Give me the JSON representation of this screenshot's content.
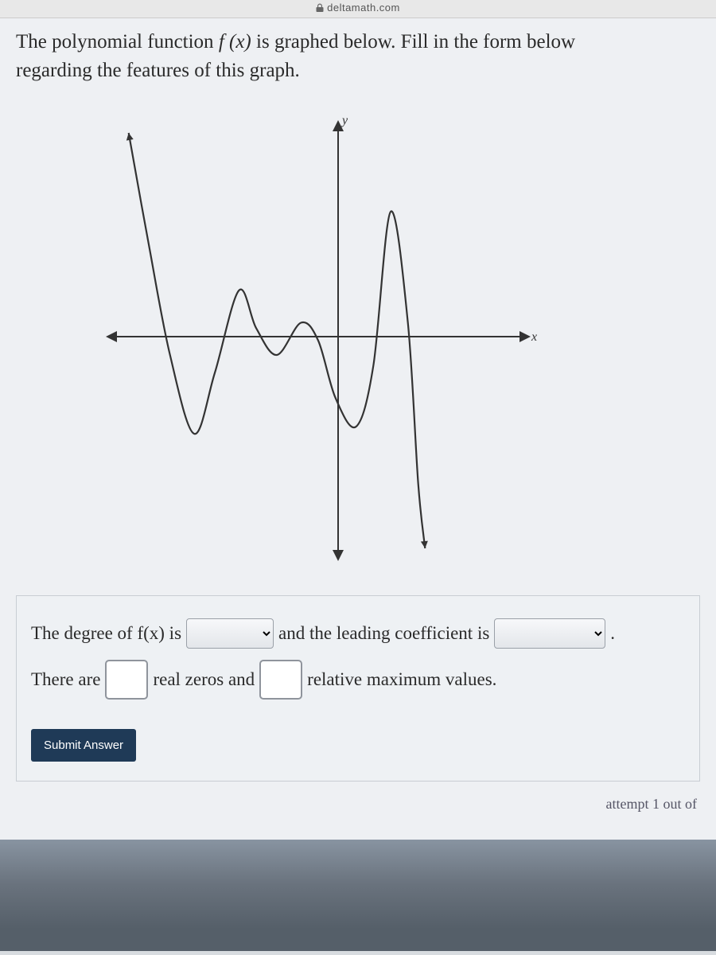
{
  "url": "deltamath.com",
  "question": {
    "line1": "The polynomial function ",
    "fx": "f (x)",
    "line1b": " is graphed below. Fill in the form below",
    "line2": "regarding the features of this graph."
  },
  "graph": {
    "x_label": "x",
    "y_label": "y"
  },
  "answers": {
    "degree_prefix": "The degree of f(x) is",
    "leading_prefix": "and the leading coefficient is",
    "zeros_prefix": "There are",
    "zeros_suffix": "real zeros and",
    "max_suffix": "relative maximum values.",
    "period": "."
  },
  "submit_label": "Submit Answer",
  "attempt_text": "attempt 1 out of",
  "chart_data": {
    "type": "line",
    "title": "",
    "xlabel": "x",
    "ylabel": "y",
    "xlim": [
      -6,
      6
    ],
    "ylim": [
      -6,
      6
    ],
    "series": [
      {
        "name": "f(x)",
        "x": [
          -5.5,
          -4.9,
          -4.3,
          -3.6,
          -3.0,
          -2.3,
          -1.8,
          -1.2,
          -0.5,
          0.0,
          0.5,
          1.1,
          1.6,
          2.1,
          2.6,
          2.9,
          3.1
        ],
        "y": [
          5.8,
          2.6,
          -0.4,
          -2.6,
          -0.9,
          1.4,
          0.35,
          -0.4,
          0.5,
          0.0,
          -1.6,
          -2.4,
          -0.7,
          3.6,
          0.5,
          -4.0,
          -5.8
        ]
      }
    ],
    "real_zeros_count": 7,
    "relative_maxima_count": 3
  }
}
